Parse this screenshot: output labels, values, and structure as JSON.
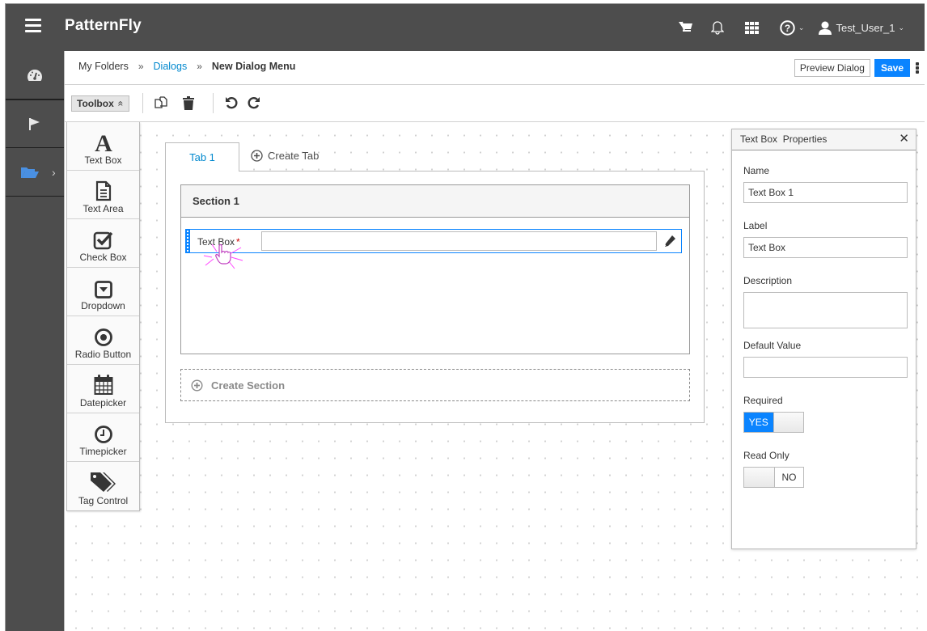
{
  "masthead": {
    "brand": "PatternFly",
    "icons": [
      "cart-icon",
      "bell-icon",
      "apps-grid-icon",
      "help-icon"
    ],
    "user_name": "Test_User_1"
  },
  "vertical_nav": {
    "items": [
      {
        "icon": "dashboard-icon",
        "active": false
      },
      {
        "icon": "flag-icon",
        "active": false
      },
      {
        "icon": "folder-open-icon",
        "active": true,
        "color": "#4a90e2"
      }
    ]
  },
  "breadcrumb": {
    "items": [
      "My Folders",
      "Dialogs"
    ],
    "separator": "»",
    "current": "New Dialog Menu"
  },
  "actions": {
    "preview_label": "Preview Dialog",
    "save_label": "Save"
  },
  "toolbar": {
    "toolbox_label": "Toolbox",
    "toolbox_chevron": "«",
    "icons": [
      "copy-icon",
      "trash-icon",
      "undo-icon",
      "redo-icon"
    ]
  },
  "palette": {
    "items": [
      {
        "label": "Text Box",
        "icon": "font-a-icon"
      },
      {
        "label": "Text Area",
        "icon": "document-icon"
      },
      {
        "label": "Check Box",
        "icon": "checkbox-icon"
      },
      {
        "label": "Dropdown",
        "icon": "dropdown-icon"
      },
      {
        "label": "Radio Button",
        "icon": "radio-icon"
      },
      {
        "label": "Datepicker",
        "icon": "calendar-icon"
      },
      {
        "label": "Timepicker",
        "icon": "clock-icon"
      },
      {
        "label": "Tag Control",
        "icon": "tags-icon"
      }
    ]
  },
  "editor": {
    "tabs": [
      {
        "label": "Tab 1",
        "active": true
      }
    ],
    "create_tab_label": "Create Tab",
    "sections": [
      {
        "title": "Section 1",
        "fields": [
          {
            "label": "Text Box",
            "required": true,
            "required_mark": "*",
            "value": ""
          }
        ]
      }
    ],
    "create_section_label": "Create Section"
  },
  "properties": {
    "title": "Text Box  Properties",
    "close": "✕",
    "name_label": "Name",
    "name_value": "Text Box 1",
    "label_label": "Label",
    "label_value": "Text Box",
    "description_label": "Description",
    "description_value": "",
    "default_label": "Default Value",
    "default_value": "",
    "required_label": "Required",
    "required_state": "YES",
    "readonly_label": "Read Only",
    "readonly_state": "NO"
  },
  "colors": {
    "accent": "#0a84ff",
    "link": "#0088ce",
    "masthead": "#4d4d4d",
    "required": "#cc0000"
  }
}
